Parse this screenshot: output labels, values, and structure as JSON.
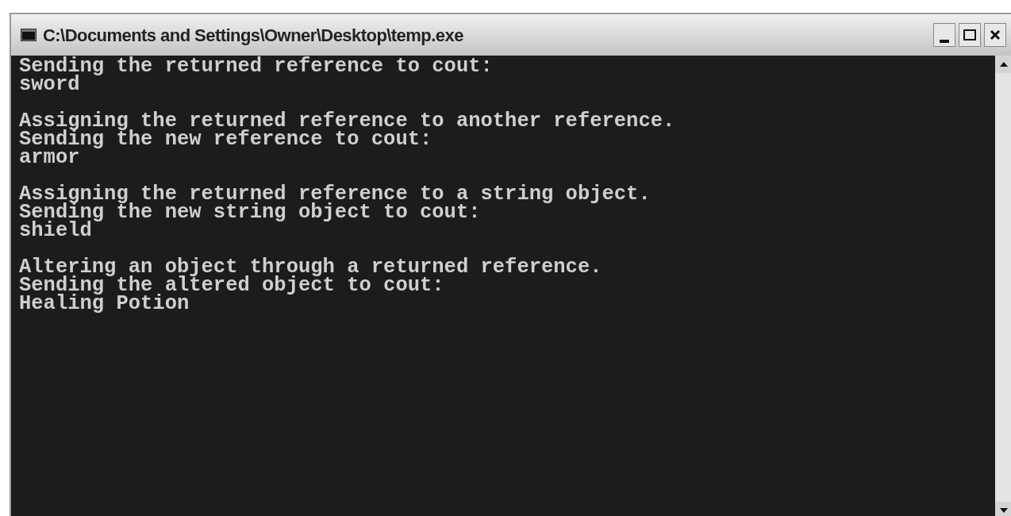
{
  "window": {
    "title": "C:\\Documents and Settings\\Owner\\Desktop\\temp.exe"
  },
  "console": {
    "blocks": [
      [
        "Sending the returned reference to cout:",
        "sword"
      ],
      [
        "Assigning the returned reference to another reference.",
        "Sending the new reference to cout:",
        "armor"
      ],
      [
        "Assigning the returned reference to a string object.",
        "Sending the new string object to cout:",
        "shield"
      ],
      [
        "Altering an object through a returned reference.",
        "Sending the altered object to cout:",
        "Healing Potion"
      ]
    ]
  }
}
